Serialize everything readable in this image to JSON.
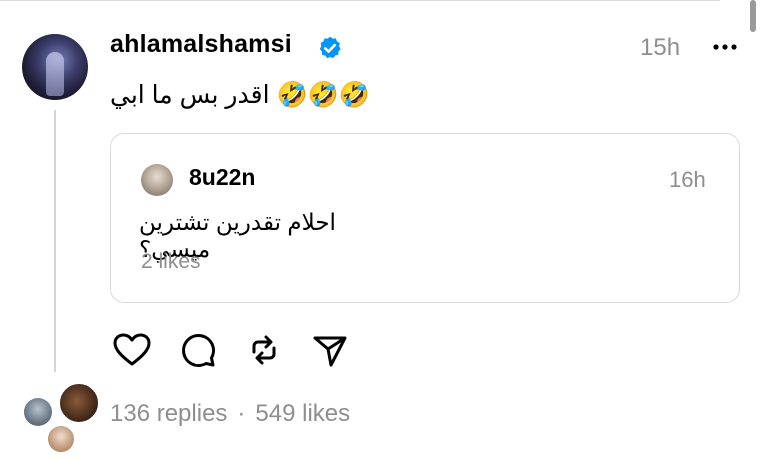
{
  "post": {
    "username": "ahlamalshamsi",
    "verified": true,
    "timestamp": "15h",
    "text": "اقدر بس ما ابي",
    "emoji": "🤣🤣🤣",
    "more_icon": "more-horizontal-icon"
  },
  "quote": {
    "username": "8u22n",
    "timestamp": "16h",
    "text": "احلام تقدرين تشترين ميسي؟",
    "likes": "2 likes"
  },
  "actions": [
    {
      "icon": "heart-icon"
    },
    {
      "icon": "comment-icon"
    },
    {
      "icon": "repost-icon"
    },
    {
      "icon": "share-icon"
    }
  ],
  "stats": {
    "replies": "136 replies",
    "separator": "·",
    "likes": "549 likes"
  },
  "colors": {
    "text": "#000000",
    "muted": "#8e8e8e",
    "border": "#d9d9d9",
    "verified_blue": "#0095f6"
  }
}
